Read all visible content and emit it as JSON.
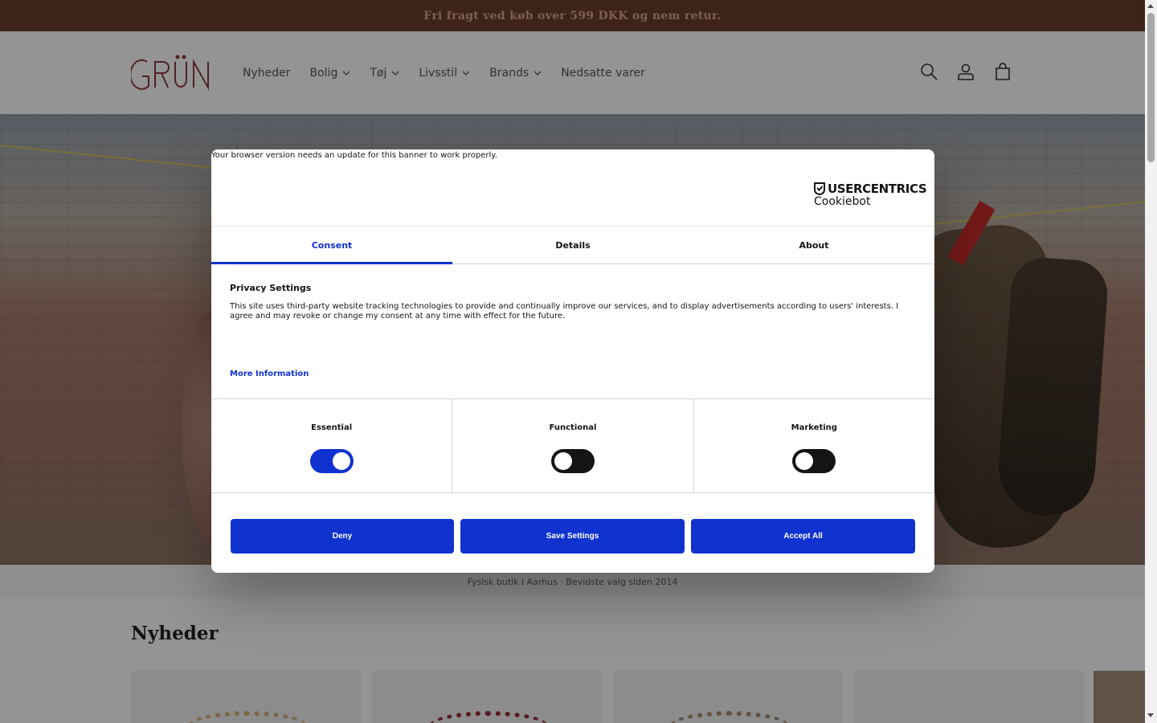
{
  "announcement": "Fri fragt ved køb over 599 DKK og nem retur.",
  "header": {
    "logo_text": "GRÜN",
    "nav": [
      {
        "label": "Nyheder",
        "dropdown": false
      },
      {
        "label": "Bolig",
        "dropdown": true
      },
      {
        "label": "Tøj",
        "dropdown": true
      },
      {
        "label": "Livsstil",
        "dropdown": true
      },
      {
        "label": "Brands",
        "dropdown": true
      },
      {
        "label": "Nedsatte varer",
        "dropdown": false
      }
    ],
    "icons": [
      "search-icon",
      "account-icon",
      "cart-icon"
    ]
  },
  "tagline": "Fysisk butik i Aarhus · Bevidste valg siden 2014",
  "section": {
    "title": "Nyheder"
  },
  "colors": {
    "announce_bg": "#6b3d2b",
    "accent_blue": "#1032cf",
    "text_dark": "#141414"
  },
  "cookie_dialog": {
    "browser_note": "Your browser version needs an update for this banner to work properly.",
    "brand_top": "USERCENTRICS",
    "brand_bottom": "Cookiebot",
    "tabs": [
      {
        "label": "Consent",
        "active": true
      },
      {
        "label": "Details",
        "active": false
      },
      {
        "label": "About",
        "active": false
      }
    ],
    "privacy_title": "Privacy Settings",
    "privacy_text": "This site uses third-party website tracking technologies to provide and continually improve our services, and to display advertisements according to users' interests. I agree and may revoke or change my consent at any time with effect for the future.",
    "more_info": "More Information",
    "categories": [
      {
        "label": "Essential",
        "enabled": true
      },
      {
        "label": "Functional",
        "enabled": false
      },
      {
        "label": "Marketing",
        "enabled": false
      }
    ],
    "buttons": {
      "deny": "Deny",
      "save": "Save Settings",
      "accept": "Accept All"
    }
  }
}
